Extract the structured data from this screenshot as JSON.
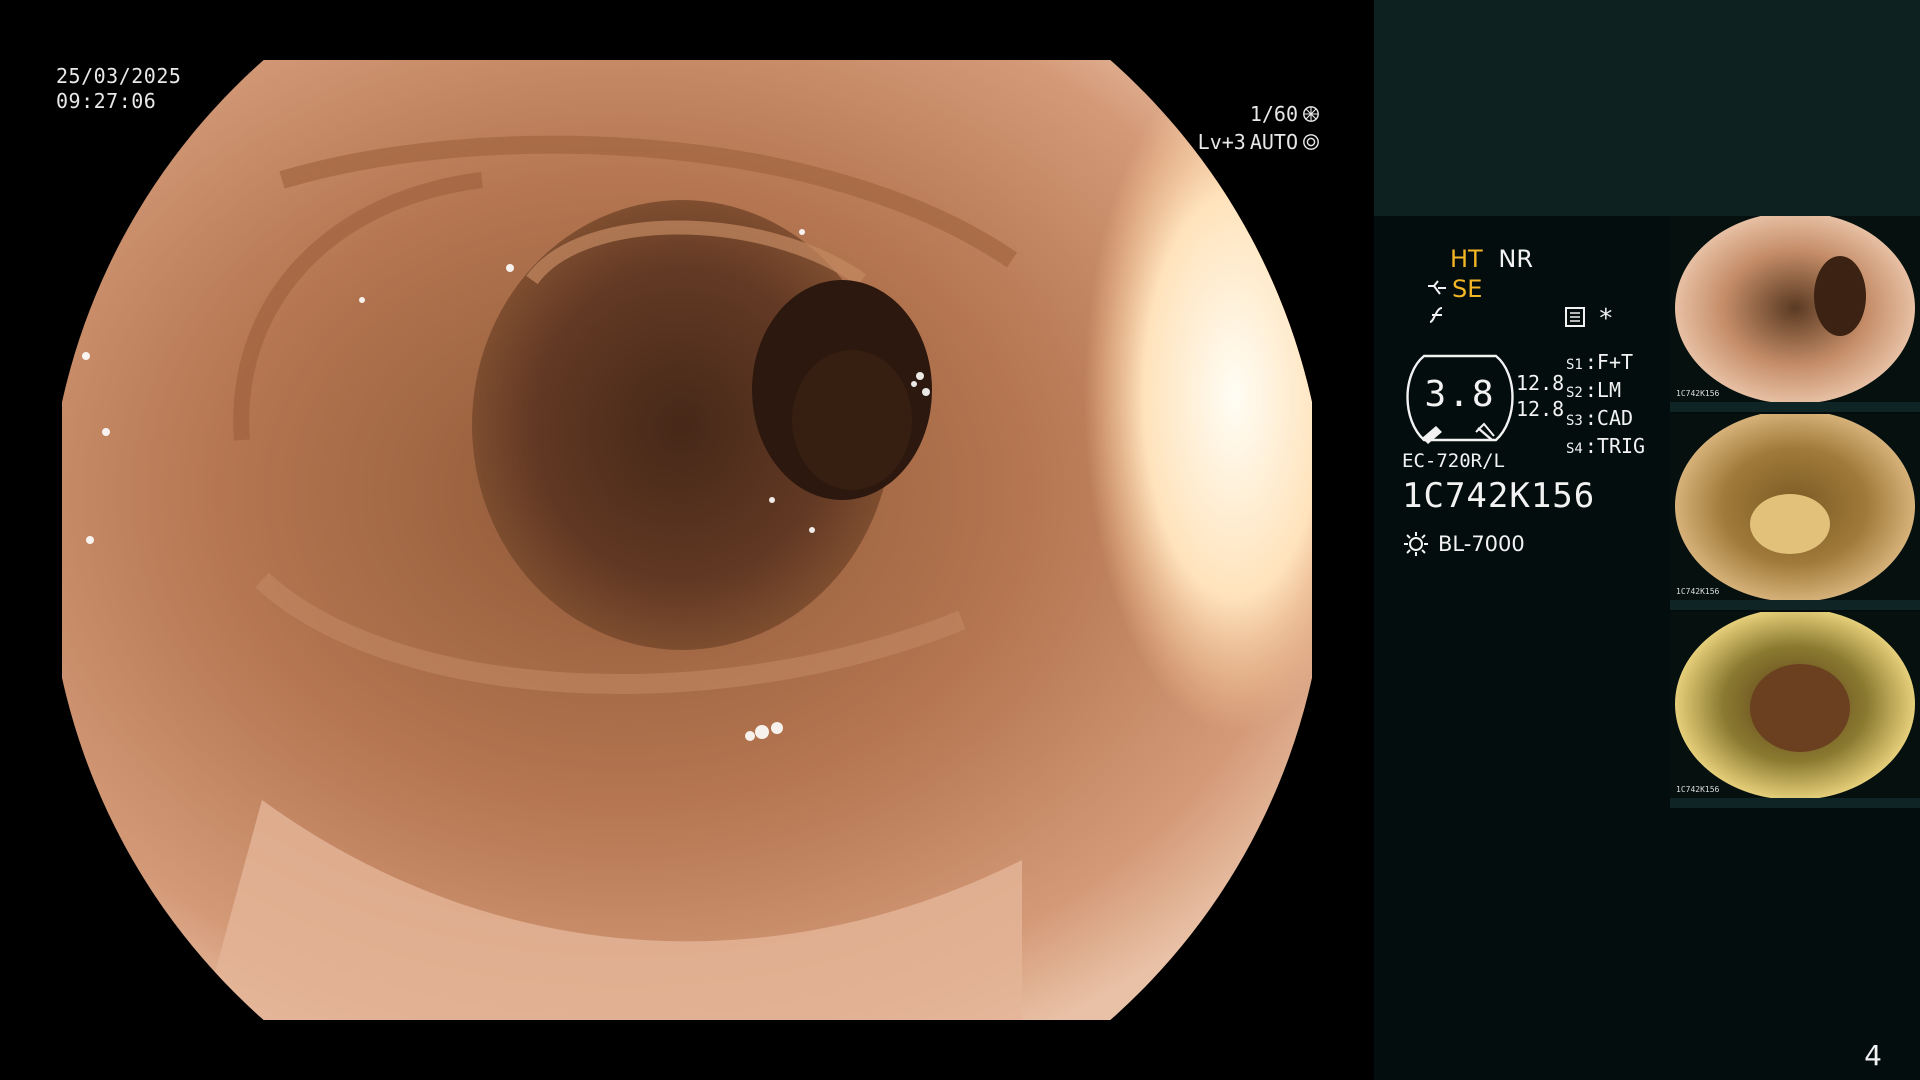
{
  "overlay": {
    "date": "25/03/2025",
    "time": "09:27:06",
    "shutter": "1/60",
    "level": "Lv+3",
    "exposure_mode": "AUTO"
  },
  "side_panel": {
    "mode_ht": "HT",
    "mode_nr": "NR",
    "mode_se": "SE",
    "gauge_value": "3.8",
    "gauge_num_1": "12.8",
    "gauge_num_2": "12.8",
    "star": "*",
    "settings": [
      {
        "key": "S1",
        "value": "F+T"
      },
      {
        "key": "S2",
        "value": "LM"
      },
      {
        "key": "S3",
        "value": "CAD"
      },
      {
        "key": "S4",
        "value": "TRIG"
      }
    ],
    "scope_model": "EC-720R/L",
    "serial": "1C742K156",
    "light_source": "BL-7000",
    "thumbnails": [
      {
        "label": "1C742K156"
      },
      {
        "label": "1C742K156"
      },
      {
        "label": "1C742K156"
      }
    ]
  },
  "page_number": "4",
  "colors": {
    "panel_top": "#0d2121",
    "panel_bg": "#030d0d",
    "accent_yellow": "#f5b626"
  }
}
